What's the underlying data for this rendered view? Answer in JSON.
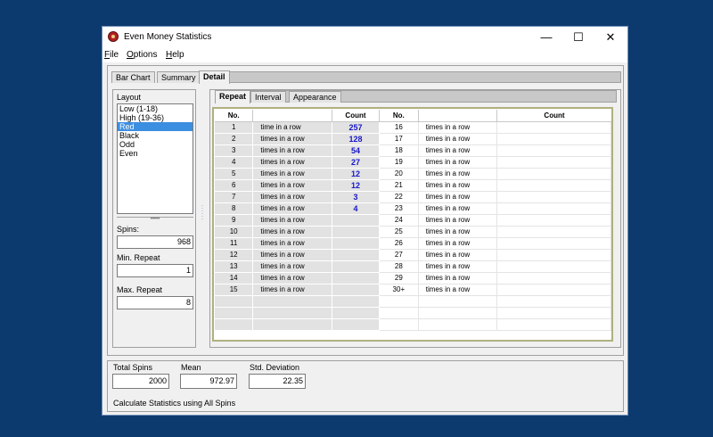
{
  "window": {
    "title": "Even Money  Statistics"
  },
  "menu": [
    {
      "label": "ile",
      "accel": "F"
    },
    {
      "label": "ptions",
      "accel": "O"
    },
    {
      "label": "elp",
      "accel": "H"
    }
  ],
  "tabs": [
    "Bar Chart",
    "Summary",
    "Detail"
  ],
  "layout": {
    "label": "Layout",
    "items": [
      "Low (1-18)",
      "High (19-36)",
      "Red",
      "Black",
      "Odd",
      "Even"
    ],
    "selected": "Red"
  },
  "fields": {
    "spins_label": "Spins:",
    "spins": "968",
    "min_repeat_label": "Min. Repeat",
    "min_repeat": "1",
    "max_repeat_label": "Max. Repeat",
    "max_repeat": "8"
  },
  "subtabs": [
    "Repeat",
    "Interval",
    "Appearance"
  ],
  "grid": {
    "headers": [
      "No.",
      "",
      "Count",
      "No.",
      "",
      "Count"
    ],
    "left_rows": [
      {
        "no": "1",
        "text": "time in a row",
        "count": "257"
      },
      {
        "no": "2",
        "text": "times in a row",
        "count": "128"
      },
      {
        "no": "3",
        "text": "times in a row",
        "count": "54"
      },
      {
        "no": "4",
        "text": "times in a row",
        "count": "27"
      },
      {
        "no": "5",
        "text": "times in a row",
        "count": "12"
      },
      {
        "no": "6",
        "text": "times in a row",
        "count": "12"
      },
      {
        "no": "7",
        "text": "times in a row",
        "count": "3"
      },
      {
        "no": "8",
        "text": "times in a row",
        "count": "4"
      },
      {
        "no": "9",
        "text": "times in a row",
        "count": ""
      },
      {
        "no": "10",
        "text": "times in a row",
        "count": ""
      },
      {
        "no": "11",
        "text": "times in a row",
        "count": ""
      },
      {
        "no": "12",
        "text": "times in a row",
        "count": ""
      },
      {
        "no": "13",
        "text": "times in a row",
        "count": ""
      },
      {
        "no": "14",
        "text": "times in a row",
        "count": ""
      },
      {
        "no": "15",
        "text": "times in a row",
        "count": ""
      }
    ],
    "right_rows": [
      {
        "no": "16",
        "text": "times in a row",
        "count": ""
      },
      {
        "no": "17",
        "text": "times in a row",
        "count": ""
      },
      {
        "no": "18",
        "text": "times in a row",
        "count": ""
      },
      {
        "no": "19",
        "text": "times in a row",
        "count": ""
      },
      {
        "no": "20",
        "text": "times in a row",
        "count": ""
      },
      {
        "no": "21",
        "text": "times in a row",
        "count": ""
      },
      {
        "no": "22",
        "text": "times in a row",
        "count": ""
      },
      {
        "no": "23",
        "text": "times in a row",
        "count": ""
      },
      {
        "no": "24",
        "text": "times in a row",
        "count": ""
      },
      {
        "no": "25",
        "text": "times in a row",
        "count": ""
      },
      {
        "no": "26",
        "text": "times in a row",
        "count": ""
      },
      {
        "no": "27",
        "text": "times in a row",
        "count": ""
      },
      {
        "no": "28",
        "text": "times in a row",
        "count": ""
      },
      {
        "no": "29",
        "text": "times in a row",
        "count": ""
      },
      {
        "no": "30+",
        "text": "times in a row",
        "count": ""
      }
    ]
  },
  "bottom": {
    "total_spins_label": "Total Spins",
    "total_spins": "2000",
    "mean_label": "Mean",
    "mean": "972.97",
    "std_label": "Std. Deviation",
    "std": "22.35",
    "note": "Calculate Statistics using All Spins"
  },
  "colors": {
    "desktop": "#0d3a6e",
    "selection": "#3c8ee0",
    "count_text": "#1818c8"
  }
}
